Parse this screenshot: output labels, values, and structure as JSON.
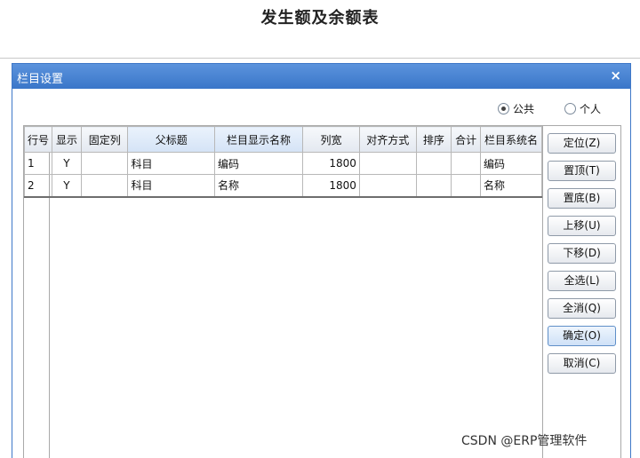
{
  "page": {
    "title": "发生额及余额表"
  },
  "dialog": {
    "title": "栏目设置",
    "close_glyph": "×",
    "scope": {
      "options": [
        {
          "label": "公共",
          "checked": true
        },
        {
          "label": "个人",
          "checked": false
        }
      ]
    },
    "table": {
      "columns": [
        "行号",
        "显示",
        "固定列",
        "父标题",
        "栏目显示名称",
        "列宽",
        "对齐方式",
        "排序",
        "合计",
        "栏目系统名"
      ],
      "rows": [
        {
          "row_no": "1",
          "show": "Y",
          "fixed": "",
          "parent": "科目",
          "display_name": "编码",
          "width": "1800",
          "align": "",
          "sort": "",
          "sum": "",
          "system_name": "编码"
        },
        {
          "row_no": "2",
          "show": "Y",
          "fixed": "",
          "parent": "科目",
          "display_name": "名称",
          "width": "1800",
          "align": "",
          "sort": "",
          "sum": "",
          "system_name": "名称"
        }
      ]
    },
    "buttons": [
      {
        "label": "定位(Z)"
      },
      {
        "label": "置顶(T)"
      },
      {
        "label": "置底(B)"
      },
      {
        "label": "上移(U)"
      },
      {
        "label": "下移(D)"
      },
      {
        "label": "全选(L)"
      },
      {
        "label": "全消(Q)"
      },
      {
        "label": "确定(O)",
        "active": true
      },
      {
        "label": "取消(C)"
      }
    ]
  },
  "watermark": "CSDN @ERP管理软件",
  "colors": {
    "titlebar": "#4a86d2",
    "grid_border": "#a9a9a9",
    "active_button": "#cfe1f7"
  }
}
